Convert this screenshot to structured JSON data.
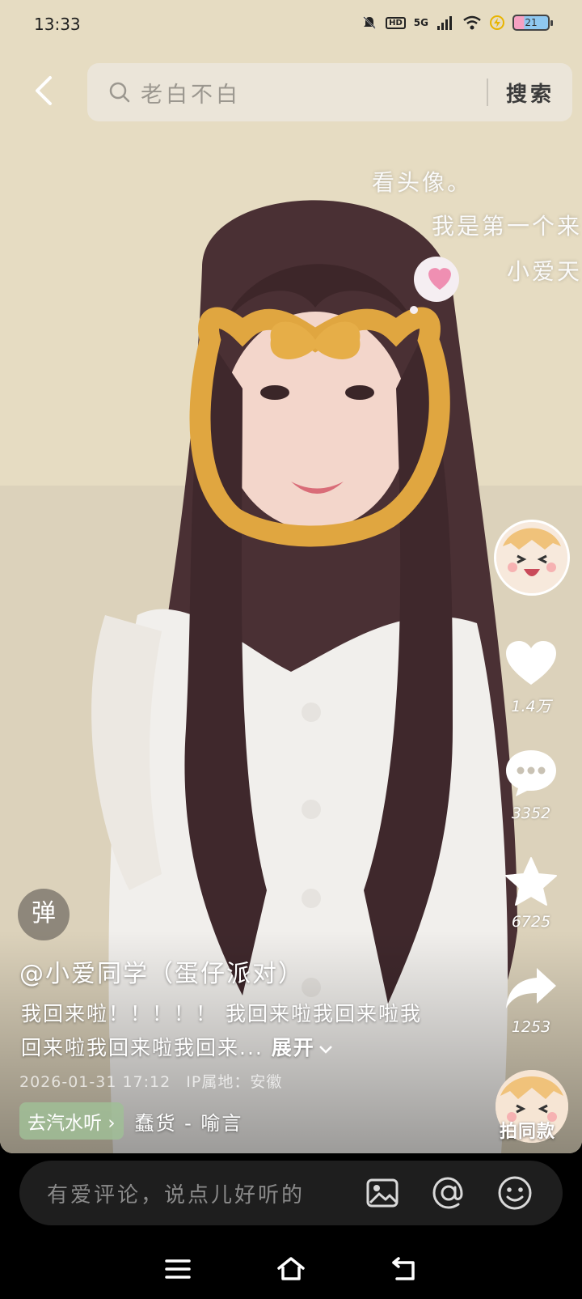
{
  "status_bar": {
    "time": "13:33",
    "network": "5G",
    "hd_label": "HD",
    "battery": "21"
  },
  "search": {
    "query": "老白不白",
    "button_label": "搜索"
  },
  "lyrics": {
    "line1": "看头像。",
    "line2": "我是第一个来",
    "line3": "小爱天"
  },
  "actions": {
    "likes": "1.4万",
    "comments": "3352",
    "favorites": "6725",
    "shares": "1253"
  },
  "danmu_label": "弹",
  "post": {
    "author": "@小爱同学（蛋仔派对）",
    "description": "我回来啦！！！！！ 我回来啦我回来啦我回来啦我回来啦我回来...",
    "expand_label": "展开",
    "date": "2026-01-31 17:12",
    "ip_location": "IP属地：安徽"
  },
  "music": {
    "tag_label": "去汽水听",
    "name": "蠢货 - 喻言"
  },
  "same_style_label": "拍同款",
  "comment_bar": {
    "placeholder": "有爱评论，说点儿好听的"
  },
  "colors": {
    "comment_bar_bg": "#1e1e1e",
    "music_tag_bg": "#a0be96"
  }
}
